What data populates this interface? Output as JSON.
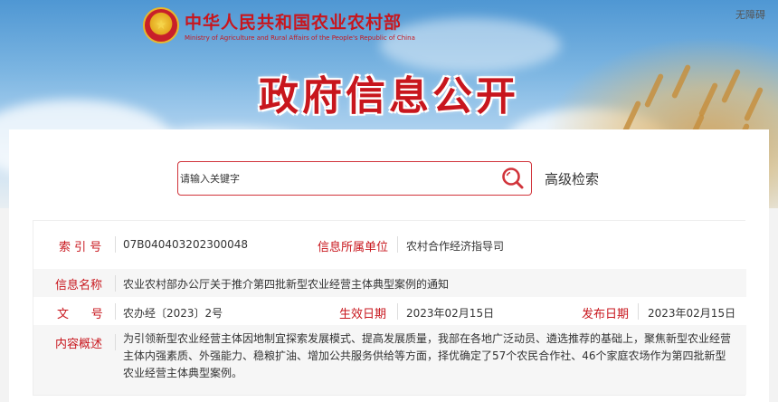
{
  "header": {
    "site_name_cn": "中华人民共和国农业农村部",
    "site_name_en": "Ministry of Agriculture and Rural Affairs of the People's Republic of China",
    "accessibility": "无障碍",
    "section_title": "政府信息公开",
    "emblem_glyph": "★"
  },
  "search": {
    "placeholder": "请输入关键字",
    "advanced_label": "高级检索",
    "accent_color": "#d1343b"
  },
  "info": {
    "index_label": "索 引 号",
    "index_value": "07B040403202300048",
    "org_label": "信息所属单位",
    "org_value": "农村合作经济指导司",
    "name_label": "信息名称",
    "name_value": "农业农村部办公厅关于推介第四批新型农业经营主体典型案例的通知",
    "doc_label": "文      号",
    "doc_value": "农办经〔2023〕2号",
    "effective_label": "生效日期",
    "effective_value": "2023年02月15日",
    "publish_label": "发布日期",
    "publish_value": "2023年02月15日",
    "summary_label": "内容概述",
    "summary_value": "为引领新型农业经营主体因地制宜探索发展模式、提高发展质量，我部在各地广泛动员、遴选推荐的基础上，聚焦新型农业经营主体内强素质、外强能力、稳粮扩油、增加公共服务供给等方面，择优确定了57个农民合作社、46个家庭农场作为第四批新型农业经营主体典型案例。"
  },
  "colors": {
    "brand_red": "#c8161d",
    "text": "#333333",
    "row_shade": "#f6f6f6"
  }
}
